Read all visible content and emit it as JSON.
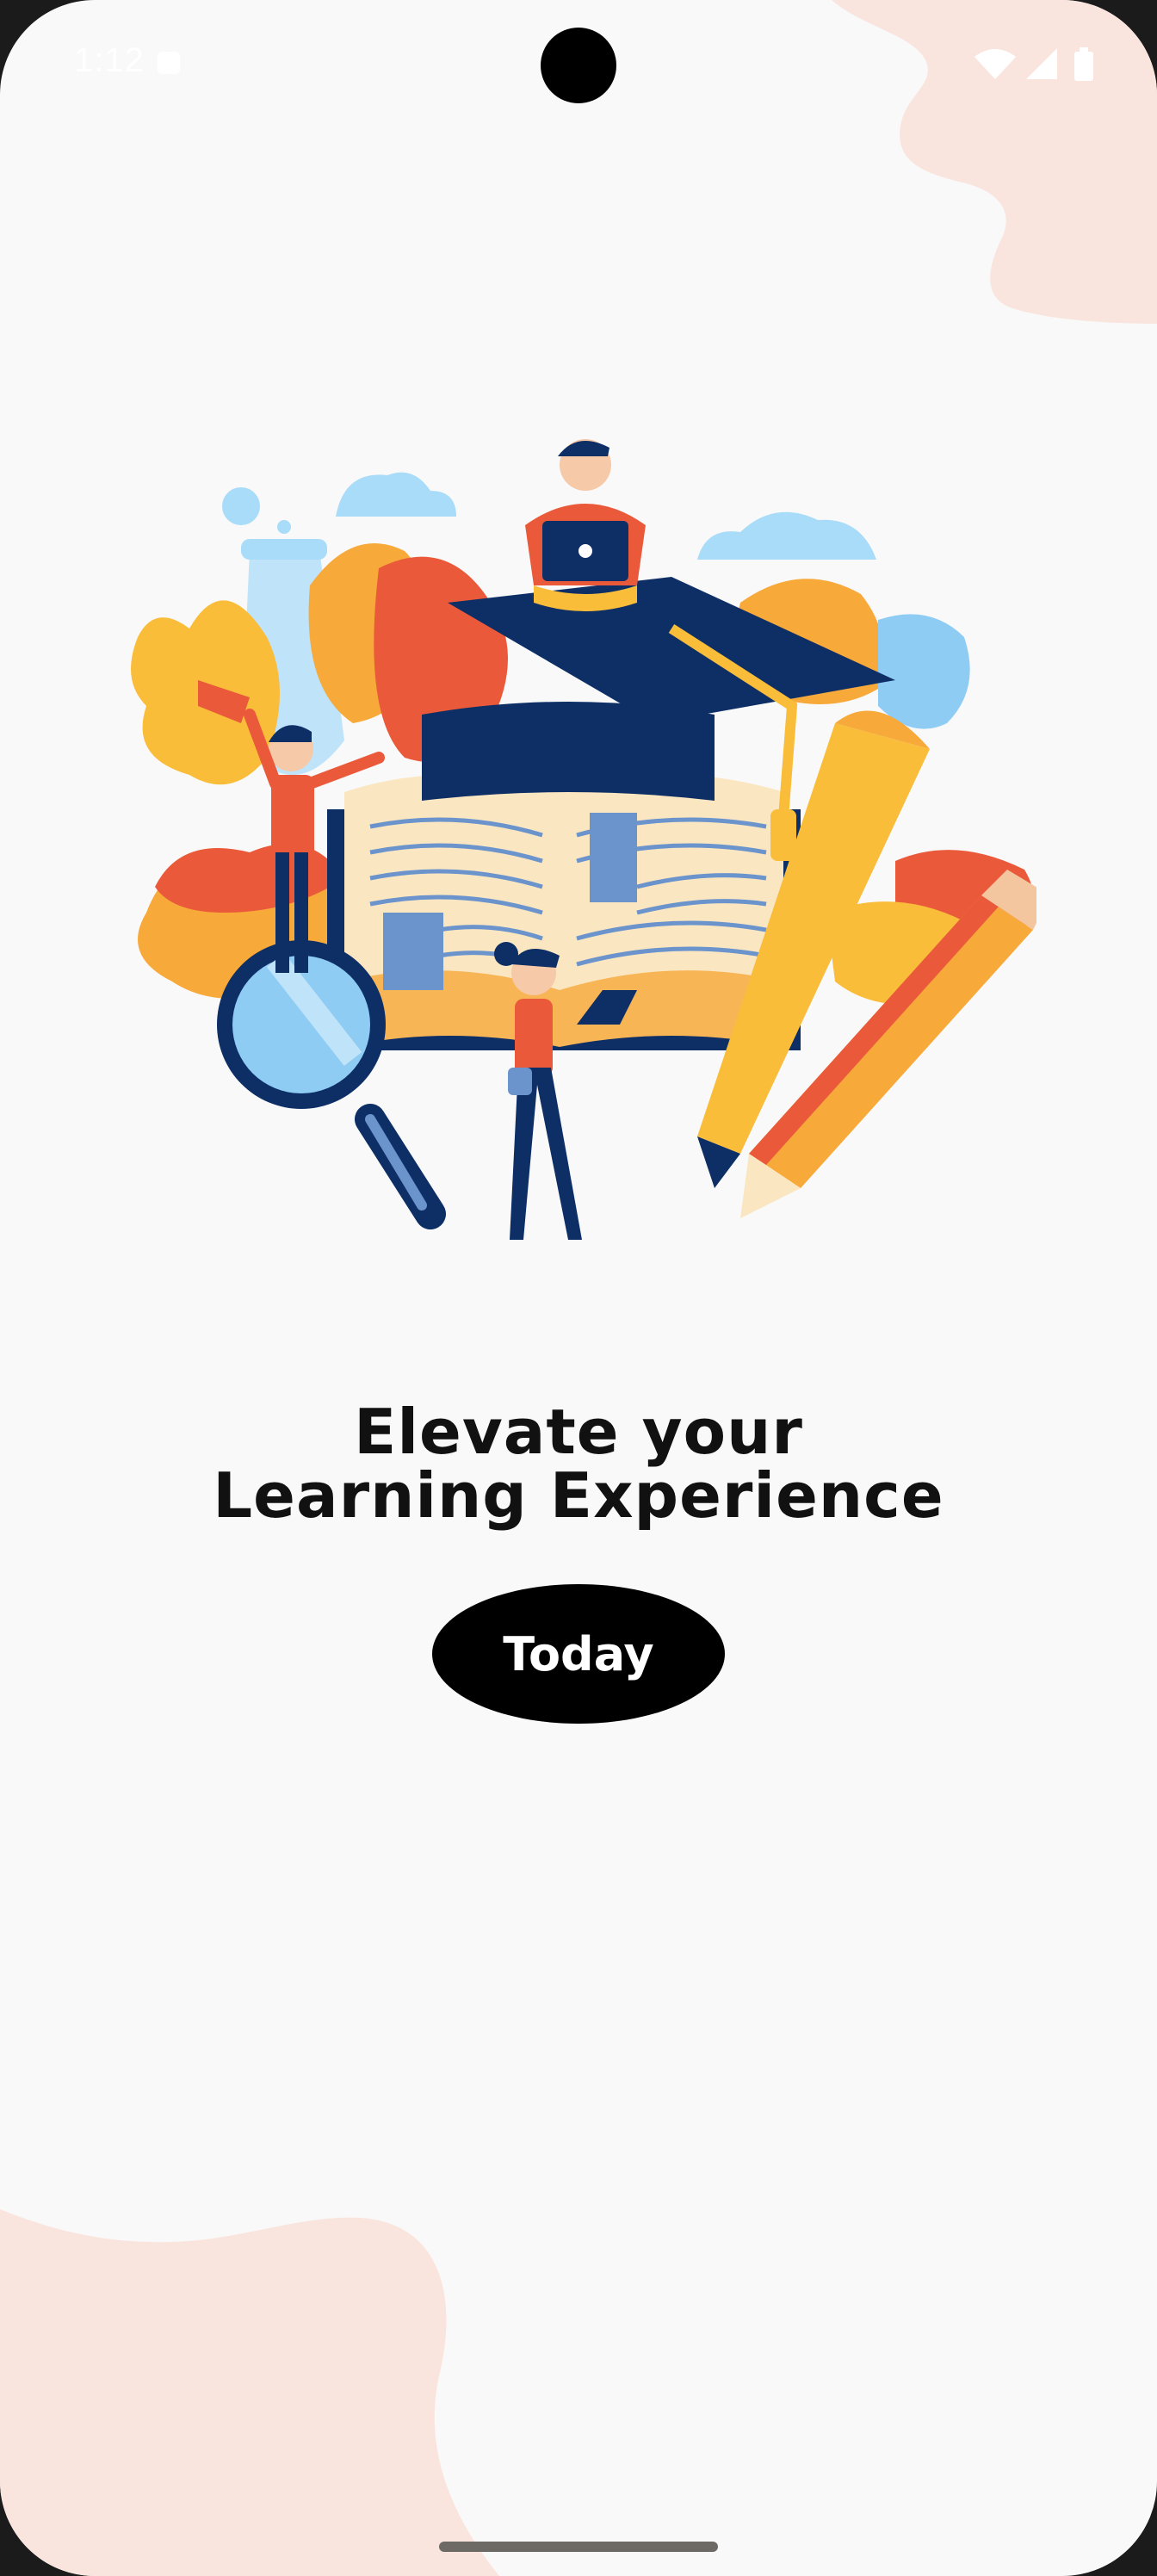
{
  "status_bar": {
    "time": "1:12",
    "icons": [
      "notification-icon",
      "wifi-icon",
      "signal-icon",
      "battery-icon"
    ]
  },
  "hero": {
    "image": "education-illustration",
    "headline_line1": "Elevate your",
    "headline_line2": "Learning Experience"
  },
  "cta": {
    "label": "Today"
  },
  "colors": {
    "background": "#f9f9f9",
    "blob": "#fae5de",
    "button": "#000000",
    "button_text": "#ffffff",
    "headline": "#111111",
    "navy": "#0d2f66",
    "orange": "#f7a93a",
    "red": "#ea5a3a",
    "sky": "#9fd6f7"
  }
}
